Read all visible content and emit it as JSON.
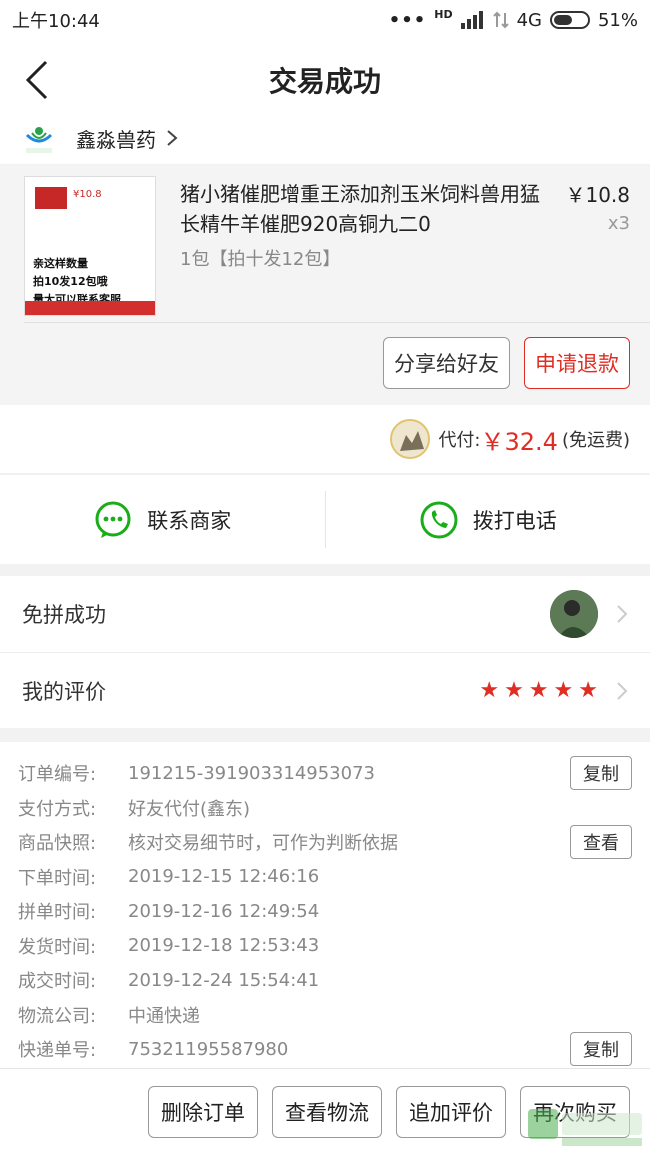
{
  "status": {
    "time": "上午10:44",
    "dots": "•••",
    "hd": "HD",
    "network": "4G",
    "battery": "51%"
  },
  "header": {
    "title": "交易成功",
    "back_icon": "back-arrow-icon"
  },
  "shop": {
    "name": "鑫淼兽药",
    "logo_text": "鑫淼兽药"
  },
  "goods": {
    "name": "猪小猪催肥增重王添加剂玉米饲料兽用猛长精牛羊催肥920高铜九二0",
    "spec": "1包【拍十发12包】",
    "price": "￥10.8",
    "qty": "x3",
    "thumb_price": "¥10.8",
    "thumb_text1": "亲这样数量",
    "thumb_text2": "拍10发12包哦",
    "thumb_text3": "量大可以联系客服",
    "share_label": "分享给好友",
    "refund_label": "申请退款"
  },
  "payment": {
    "label": "代付:",
    "amount": "￥32.4",
    "shipping": "(免运费)"
  },
  "contact": {
    "merchant_label": "联系商家",
    "phone_label": "拨打电话"
  },
  "group": {
    "free_label": "免拼成功",
    "review_label": "我的评价",
    "stars": 5
  },
  "order": {
    "rows": [
      {
        "k": "订单编号:",
        "v": "191215-391903314953073",
        "btn": "复制"
      },
      {
        "k": "支付方式:",
        "v": "好友代付(鑫东)"
      },
      {
        "k": "商品快照:",
        "v": "核对交易细节时，可作为判断依据",
        "btn": "查看"
      },
      {
        "k": "下单时间:",
        "v": "2019-12-15 12:46:16"
      },
      {
        "k": "拼单时间:",
        "v": "2019-12-16 12:49:54"
      },
      {
        "k": "发货时间:",
        "v": "2019-12-18 12:53:43"
      },
      {
        "k": "成交时间:",
        "v": "2019-12-24 15:54:41"
      },
      {
        "k": "物流公司:",
        "v": "中通快递"
      },
      {
        "k": "快递单号:",
        "v": "75321195587980",
        "btn": "复制"
      }
    ]
  },
  "footer": {
    "delete_label": "删除订单",
    "logistics_label": "查看物流",
    "review_label": "追加评价",
    "rebuy_label": "再次购买"
  },
  "colors": {
    "accent": "#e02e24",
    "wechat_green": "#1aad19"
  }
}
